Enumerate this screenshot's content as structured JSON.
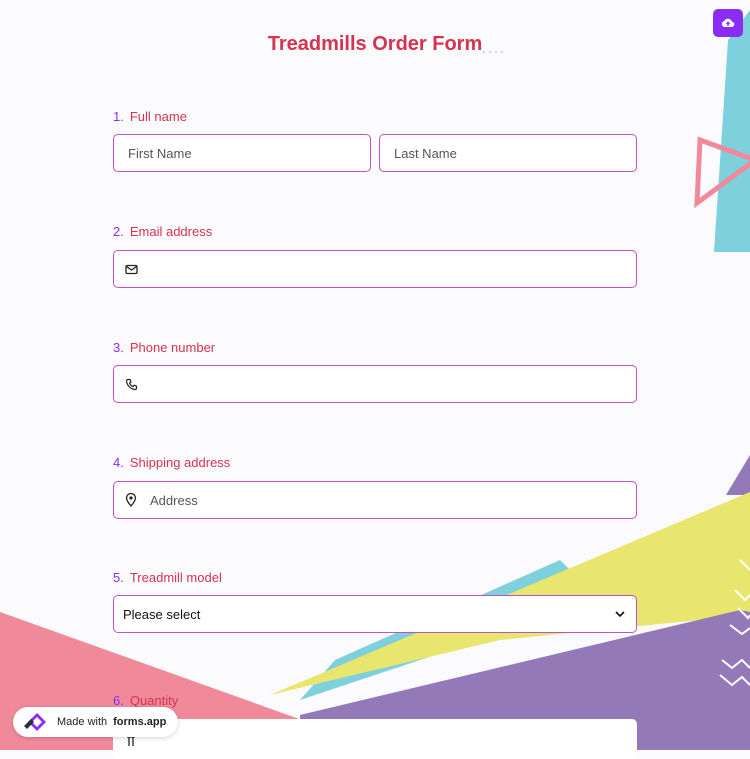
{
  "form": {
    "title": "Treadmills Order Form",
    "questions": [
      {
        "number": "1.",
        "label": "Full name",
        "fields": [
          {
            "placeholder": "First Name"
          },
          {
            "placeholder": "Last Name"
          }
        ]
      },
      {
        "number": "2.",
        "label": "Email address",
        "icon": "envelope-icon",
        "placeholder": ""
      },
      {
        "number": "3.",
        "label": "Phone number",
        "icon": "phone-icon",
        "placeholder": ""
      },
      {
        "number": "4.",
        "label": "Shipping address",
        "icon": "map-pin-icon",
        "placeholder": "Address"
      },
      {
        "number": "5.",
        "label": "Treadmill model",
        "selected": "Please select",
        "icon": "chevron-down-icon"
      },
      {
        "number": "6.",
        "label": "Quantity",
        "icon": "ruler-icon"
      }
    ]
  },
  "save_button": {
    "icon": "cloud-upload-icon"
  },
  "badge": {
    "prefix": "Made with",
    "brand": "forms.app",
    "icon": "forms-app-logo-icon"
  },
  "colors": {
    "title": "#d6334f",
    "number": "#8b2cf5",
    "field_border": "#c24fc4",
    "accent": "#8b2cf5",
    "cyan": "#7ed0dc",
    "pink": "#f08a9b",
    "yellow": "#e8e66e",
    "purple": "#9479b8"
  }
}
